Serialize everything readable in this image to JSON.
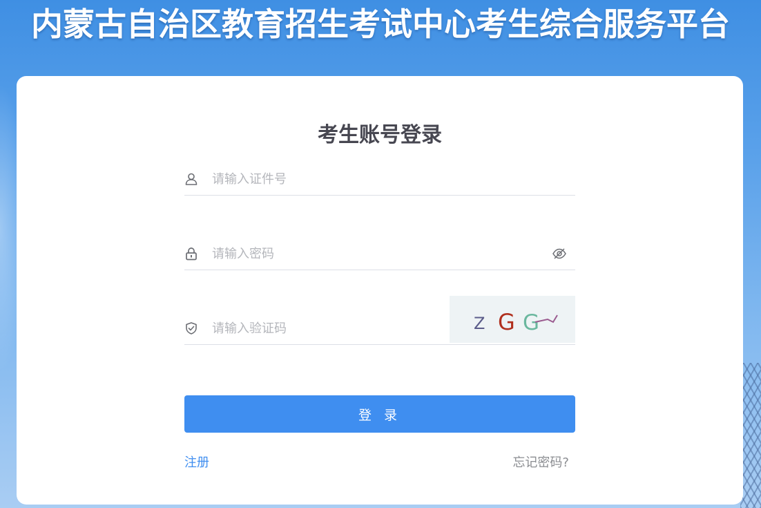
{
  "site": {
    "title": "内蒙古自治区教育招生考试中心考生综合服务平台"
  },
  "login": {
    "title": "考生账号登录",
    "id_placeholder": "请输入证件号",
    "password_placeholder": "请输入密码",
    "captcha_placeholder": "请输入验证码",
    "captcha_text": [
      "Z",
      "G",
      "G"
    ],
    "captcha_colors": [
      "#5b5c8a",
      "#b0301e",
      "#6ab79e"
    ],
    "submit_label": "登 录",
    "register_label": "注册",
    "forgot_label": "忘记密码?"
  },
  "icons": {
    "id_field": "user-icon",
    "password_field": "lock-icon",
    "captcha_field": "shield-check-icon",
    "toggle_password": "eye-off-icon"
  },
  "colors": {
    "primary": "#3f8ef0",
    "title_text": "#474751",
    "placeholder": "#b4b6bb"
  }
}
